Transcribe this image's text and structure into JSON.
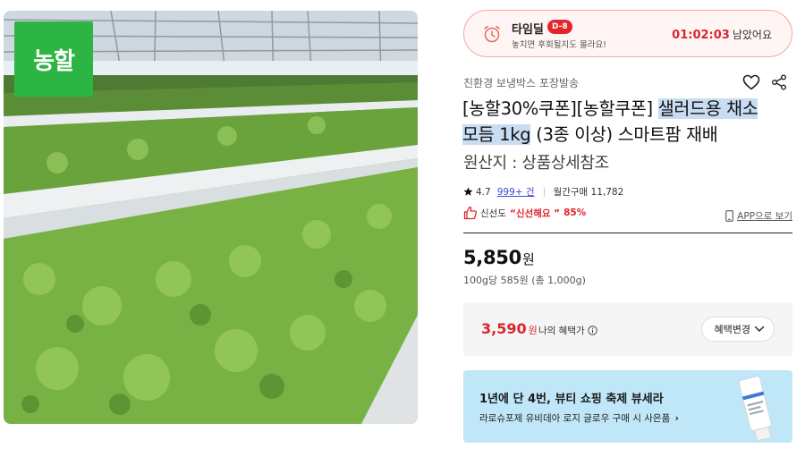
{
  "image": {
    "brand_logo_text": "농할"
  },
  "timedeal": {
    "title": "타임딜",
    "dday": "D-8",
    "subtitle": "놓치면 후회될지도 몰라요!",
    "countdown": "01:02:03",
    "countdown_suffix": "남았어요"
  },
  "product": {
    "shipping_label": "친환경 보냉박스 포장발송",
    "title_plain": "[농할30%쿠폰][농할쿠폰] ",
    "title_highlight_1": "샐러드용 채소",
    "title_highlight_2": "모듬 1kg",
    "title_rest": " (3종 이상) 스마트팜 재배",
    "origin": "원산지 : 상품상세참조",
    "rating": "4.7",
    "review_count": "999+ 건",
    "monthly_purchase": "월간구매 11,782",
    "freshness_label": "신선도",
    "freshness_quote": "“신선해요 ”",
    "freshness_pct": "85%",
    "app_link": "APP으로 보기",
    "price": "5,850",
    "price_unit": "원",
    "unit_price": "100g당 585원 (총 1,000g)"
  },
  "benefit": {
    "price": "3,590",
    "price_unit": "원",
    "label": "나의 혜택가",
    "change_button": "혜택변경"
  },
  "promo": {
    "title": "1년에 단 4번, 뷰티 쇼핑 축제 뷰세라",
    "subtitle": "라로슈포제 유비데아 로지 글로우 구매 시 사은품",
    "arrow": "›"
  },
  "colors": {
    "accent_red": "#e4262b",
    "brand_green": "#2db544",
    "promo_bg": "#bfe7f8",
    "highlight": "#c8dcf2"
  }
}
